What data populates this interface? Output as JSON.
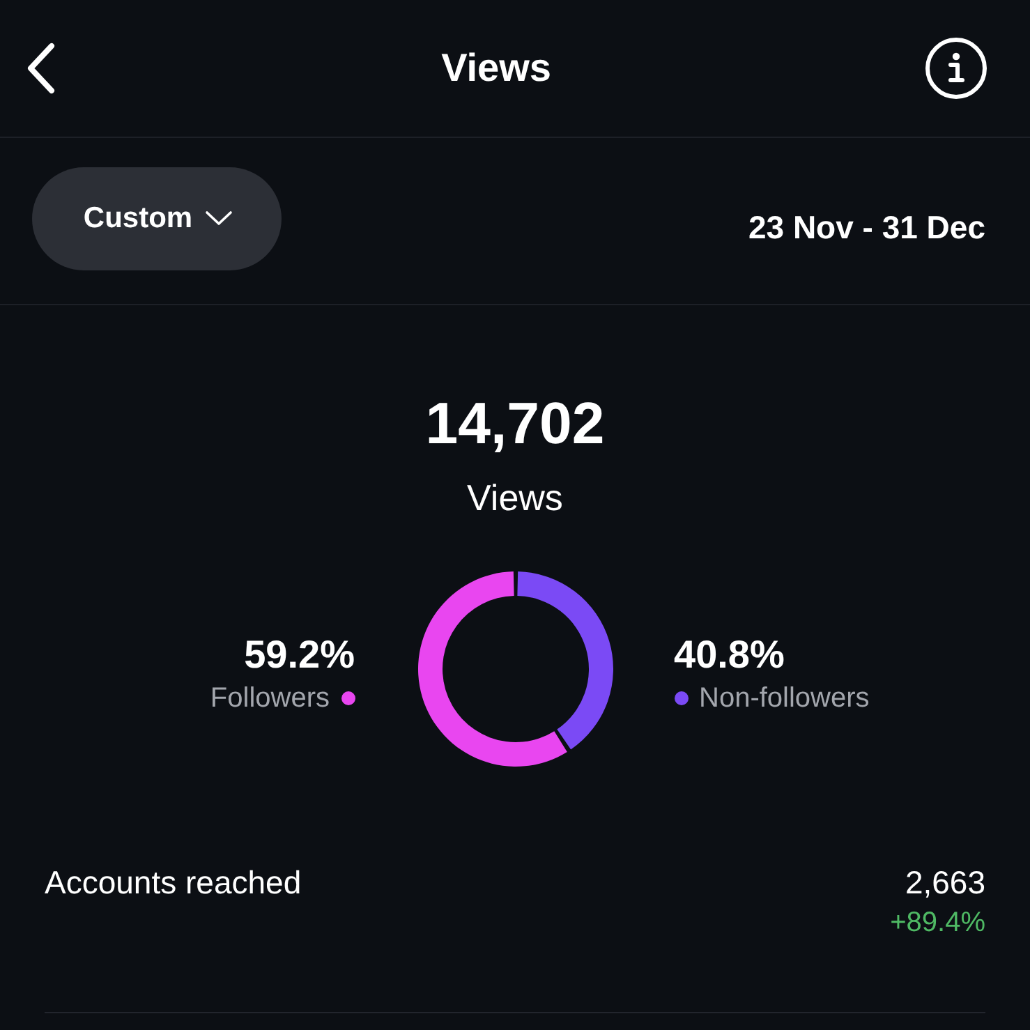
{
  "header": {
    "title": "Views"
  },
  "filter": {
    "range_button": "Custom",
    "date_range": "23 Nov - 31 Dec"
  },
  "summary": {
    "total": "14,702",
    "label": "Views"
  },
  "breakdown": {
    "chart_data": {
      "type": "donut",
      "categories": [
        "Followers",
        "Non-followers"
      ],
      "values": [
        59.2,
        40.8
      ],
      "value_labels": [
        "59.2%",
        "40.8%"
      ]
    },
    "legend": [
      {
        "color": "#e946f0"
      },
      {
        "color": "#7b4af5"
      }
    ]
  },
  "metrics": [
    {
      "label": "Accounts reached",
      "value": "2,663",
      "change": "+89.4%",
      "positive": true
    }
  ]
}
